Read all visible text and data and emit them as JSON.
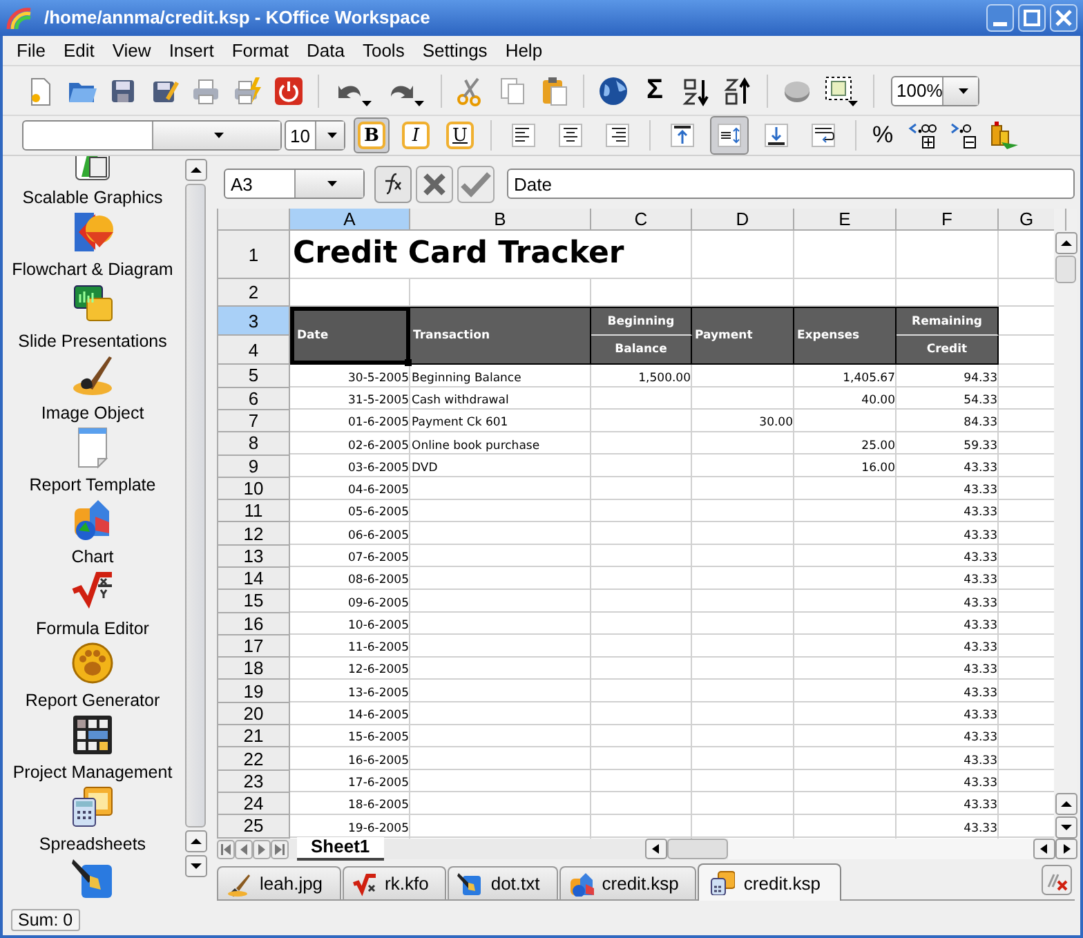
{
  "window": {
    "title": "/home/annma/credit.ksp - KOffice Workspace"
  },
  "menu": [
    "File",
    "Edit",
    "View",
    "Insert",
    "Format",
    "Data",
    "Tools",
    "Settings",
    "Help"
  ],
  "main_toolbar": {
    "sum_label": "Σ",
    "zoom": "100%"
  },
  "format_toolbar": {
    "font_size": "10",
    "styles": [
      {
        "kind": "bold",
        "label": "B",
        "pressed": true
      },
      {
        "kind": "italic",
        "label": "I",
        "pressed": false
      },
      {
        "kind": "underline",
        "label": "U",
        "pressed": false
      }
    ],
    "alignment": [
      {
        "kind": "left",
        "pressed": false
      },
      {
        "kind": "center",
        "pressed": false
      },
      {
        "kind": "right",
        "pressed": false
      }
    ],
    "vertical": [
      {
        "kind": "top",
        "pressed": false
      },
      {
        "kind": "middle",
        "pressed": true
      },
      {
        "kind": "bottom",
        "pressed": false
      },
      {
        "kind": "wrap",
        "pressed": false
      }
    ],
    "percent_label": "%"
  },
  "sidebar": {
    "items": [
      {
        "label": "Scalable Graphics"
      },
      {
        "label": "Flowchart & Diagram"
      },
      {
        "label": "Slide Presentations"
      },
      {
        "label": "Image Object"
      },
      {
        "label": "Report Template"
      },
      {
        "label": "Chart"
      },
      {
        "label": "Formula Editor"
      },
      {
        "label": "Report Generator"
      },
      {
        "label": "Project Management"
      },
      {
        "label": "Spreadsheets"
      }
    ]
  },
  "sheet": {
    "cell_reference": "A3",
    "formula": "Date",
    "columns": [
      {
        "label": "A",
        "selected": true
      },
      {
        "label": "B",
        "selected": false
      },
      {
        "label": "C",
        "selected": false
      },
      {
        "label": "D",
        "selected": false
      },
      {
        "label": "E",
        "selected": false
      },
      {
        "label": "F",
        "selected": false
      },
      {
        "label": "G",
        "selected": false
      }
    ],
    "title_row": {
      "number": "1",
      "text": "Credit Card Tracker"
    },
    "blank_row": {
      "number": "2"
    },
    "header_row_numbers": [
      {
        "label": "3",
        "selected": true
      },
      {
        "label": "4",
        "selected": false
      }
    ],
    "header_cells": [
      {
        "kind": "merged",
        "text": "Date",
        "selected": true
      },
      {
        "kind": "merged",
        "text": "Transaction",
        "selected": false
      },
      {
        "kind": "split",
        "top": "Beginning",
        "bottom": "Balance",
        "selected": false
      },
      {
        "kind": "merged",
        "text": "Payment",
        "selected": false
      },
      {
        "kind": "merged",
        "text": "Expenses",
        "selected": false
      },
      {
        "kind": "split",
        "top": "Remaining",
        "bottom": "Credit",
        "selected": false
      }
    ],
    "rows": [
      {
        "number": "5",
        "cells": [
          "30-5-2005",
          "Beginning Balance",
          "1,500.00",
          null,
          "1,405.67",
          "94.33"
        ]
      },
      {
        "number": "6",
        "cells": [
          "31-5-2005",
          "Cash withdrawal",
          null,
          null,
          "40.00",
          "54.33"
        ]
      },
      {
        "number": "7",
        "cells": [
          "01-6-2005",
          "Payment Ck 601",
          null,
          "30.00",
          null,
          "84.33"
        ]
      },
      {
        "number": "8",
        "cells": [
          "02-6-2005",
          "Online book purchase",
          null,
          null,
          "25.00",
          "59.33"
        ]
      },
      {
        "number": "9",
        "cells": [
          "03-6-2005",
          "DVD",
          null,
          null,
          "16.00",
          "43.33"
        ]
      },
      {
        "number": "10",
        "cells": [
          "04-6-2005",
          null,
          null,
          null,
          null,
          "43.33"
        ]
      },
      {
        "number": "11",
        "cells": [
          "05-6-2005",
          null,
          null,
          null,
          null,
          "43.33"
        ]
      },
      {
        "number": "12",
        "cells": [
          "06-6-2005",
          null,
          null,
          null,
          null,
          "43.33"
        ]
      },
      {
        "number": "13",
        "cells": [
          "07-6-2005",
          null,
          null,
          null,
          null,
          "43.33"
        ]
      },
      {
        "number": "14",
        "cells": [
          "08-6-2005",
          null,
          null,
          null,
          null,
          "43.33"
        ]
      },
      {
        "number": "15",
        "cells": [
          "09-6-2005",
          null,
          null,
          null,
          null,
          "43.33"
        ]
      },
      {
        "number": "16",
        "cells": [
          "10-6-2005",
          null,
          null,
          null,
          null,
          "43.33"
        ]
      },
      {
        "number": "17",
        "cells": [
          "11-6-2005",
          null,
          null,
          null,
          null,
          "43.33"
        ]
      },
      {
        "number": "18",
        "cells": [
          "12-6-2005",
          null,
          null,
          null,
          null,
          "43.33"
        ]
      },
      {
        "number": "19",
        "cells": [
          "13-6-2005",
          null,
          null,
          null,
          null,
          "43.33"
        ]
      },
      {
        "number": "20",
        "cells": [
          "14-6-2005",
          null,
          null,
          null,
          null,
          "43.33"
        ]
      },
      {
        "number": "21",
        "cells": [
          "15-6-2005",
          null,
          null,
          null,
          null,
          "43.33"
        ]
      },
      {
        "number": "22",
        "cells": [
          "16-6-2005",
          null,
          null,
          null,
          null,
          "43.33"
        ]
      },
      {
        "number": "23",
        "cells": [
          "17-6-2005",
          null,
          null,
          null,
          null,
          "43.33"
        ]
      },
      {
        "number": "24",
        "cells": [
          "18-6-2005",
          null,
          null,
          null,
          null,
          "43.33"
        ]
      },
      {
        "number": "25",
        "cells": [
          "19-6-2005",
          null,
          null,
          null,
          null,
          "43.33"
        ]
      }
    ],
    "sheet_tabs": [
      {
        "label": "Sheet1",
        "selected": true
      }
    ]
  },
  "document_tabs": [
    {
      "label": "leah.jpg",
      "selected": false
    },
    {
      "label": "rk.kfo",
      "selected": false
    },
    {
      "label": "dot.txt",
      "selected": false
    },
    {
      "label": "credit.ksp",
      "selected": false
    },
    {
      "label": "credit.ksp",
      "selected": true
    }
  ],
  "status_bar": {
    "text": "Sum: 0"
  }
}
